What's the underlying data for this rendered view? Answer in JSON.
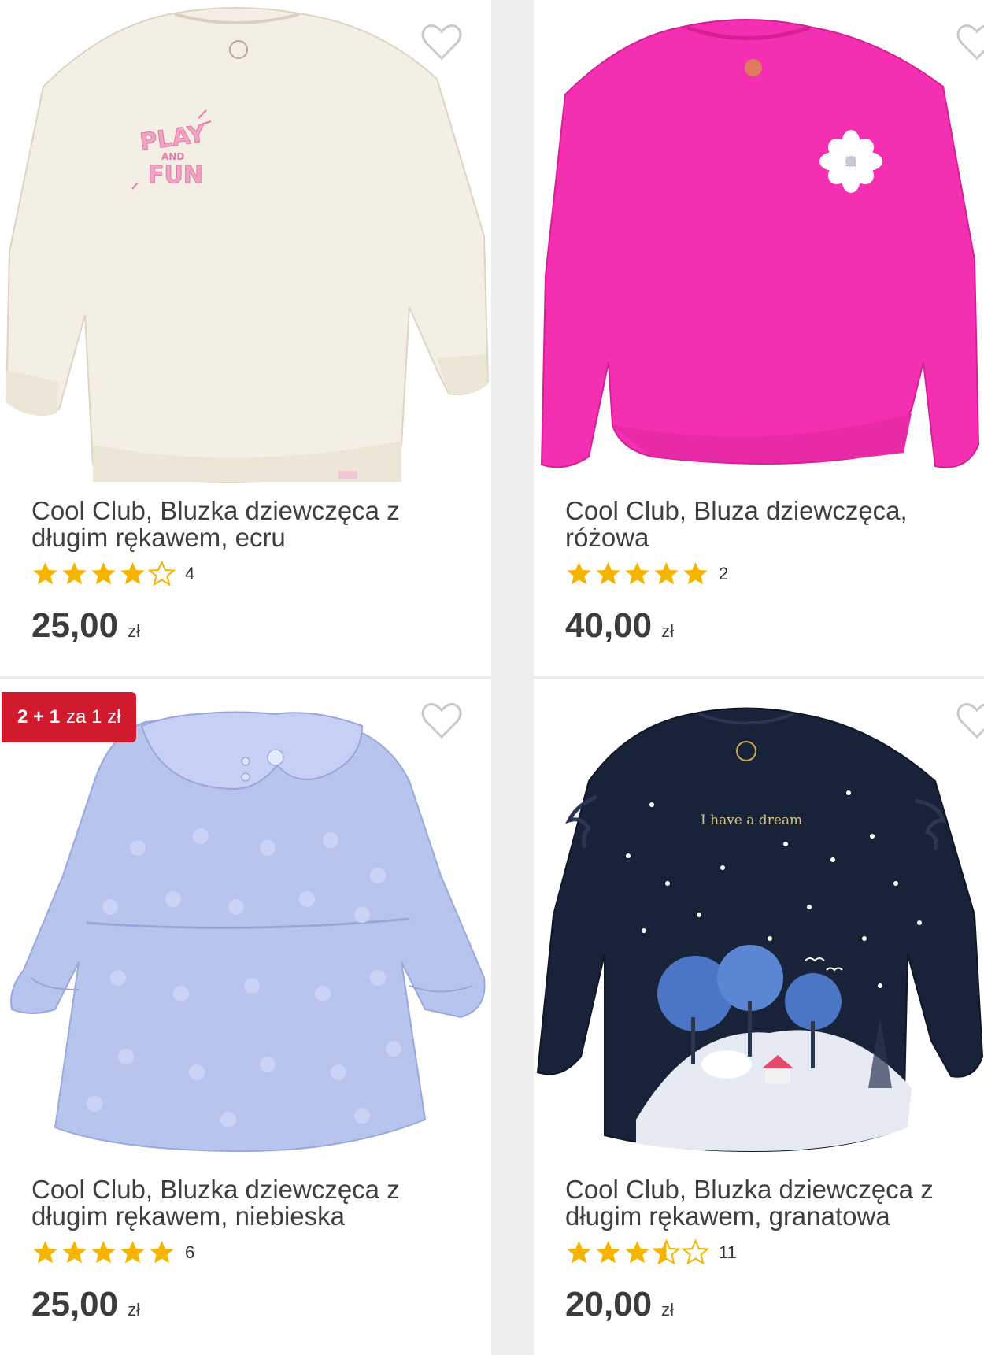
{
  "colors": {
    "star": "#f6b400",
    "promo": "#d21a2e",
    "heart": "#c9c9c9"
  },
  "products": [
    {
      "title": "Cool Club, Bluzka dziewczęca z długim rękawem, ecru",
      "rating_count": "4",
      "stars": [
        "full",
        "full",
        "full",
        "full",
        "empty"
      ],
      "price": "25,00",
      "currency": "zł",
      "badge": null,
      "image": {
        "garment": "sweatshirt",
        "color": "#f3efe4",
        "print_lines": [
          "PLAY",
          "AND",
          "FUN"
        ]
      }
    },
    {
      "title": "Cool Club, Bluza dziewczęca, różowa",
      "rating_count": "2",
      "stars": [
        "full",
        "full",
        "full",
        "full",
        "full"
      ],
      "price": "40,00",
      "currency": "zł",
      "badge": null,
      "image": {
        "garment": "sweatshirt",
        "color": "#f52fb1",
        "print": "flower"
      }
    },
    {
      "title": "Cool Club, Bluzka dziewczęca z długim rękawem, niebieska",
      "rating_count": "6",
      "stars": [
        "full",
        "full",
        "full",
        "full",
        "full"
      ],
      "price": "25,00",
      "currency": "zł",
      "badge": {
        "bold": "2 + 1",
        "rest": "za 1 zł"
      },
      "image": {
        "garment": "blouse",
        "color": "#b7c4ee"
      }
    },
    {
      "title": "Cool Club, Bluzka dziewczęca z długim rękawem, granatowa",
      "rating_count": "11",
      "stars": [
        "full",
        "full",
        "full",
        "half",
        "empty"
      ],
      "price": "20,00",
      "currency": "zł",
      "badge": null,
      "image": {
        "garment": "longsleeve",
        "color": "#182238",
        "print_text": "I have a dream"
      }
    }
  ]
}
